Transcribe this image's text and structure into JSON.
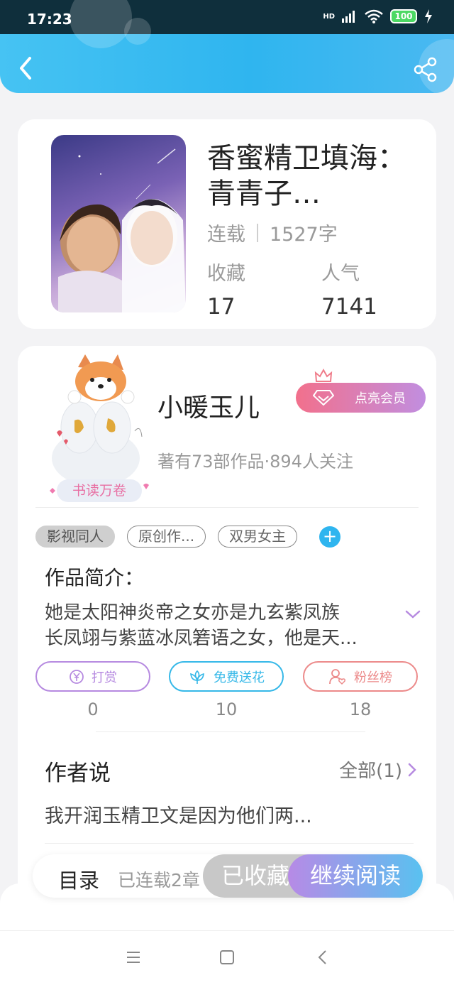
{
  "status_bar": {
    "time": "17:23",
    "battery": "100",
    "network": "HD"
  },
  "book": {
    "title": "香蜜精卫填海：青青子…",
    "status": "连载",
    "word_count": "1527字",
    "favorites_label": "收藏",
    "favorites_value": "17",
    "popularity_label": "人气",
    "popularity_value": "7141"
  },
  "author": {
    "name": "小暖玉儿",
    "vip_label": "点亮会员",
    "badge_text": "书读万卷",
    "stats": "著有73部作品·894人关注"
  },
  "tags": [
    "影视同人",
    "原创作...",
    "双男女主"
  ],
  "intro": {
    "title": "作品简介：",
    "line1": "她是太阳神炎帝之女亦是九玄紫凤族",
    "line2": "长凤翊与紫蓝冰凤箬语之女，他是天..."
  },
  "actions": [
    {
      "label": "打赏",
      "count": "0",
      "color": "#b68ae0"
    },
    {
      "label": "免费送花",
      "count": "10",
      "color": "#35b8e8"
    },
    {
      "label": "粉丝榜",
      "count": "18",
      "color": "#ec8a8a"
    }
  ],
  "author_says": {
    "title": "作者说",
    "all_label": "全部(1)",
    "text": "我开润玉精卫文是因为他们两..."
  },
  "bottom_bar": {
    "toc_label": "目录",
    "toc_count": "已连载2章",
    "favorited_label": "已收藏",
    "continue_label": "继续阅读"
  }
}
